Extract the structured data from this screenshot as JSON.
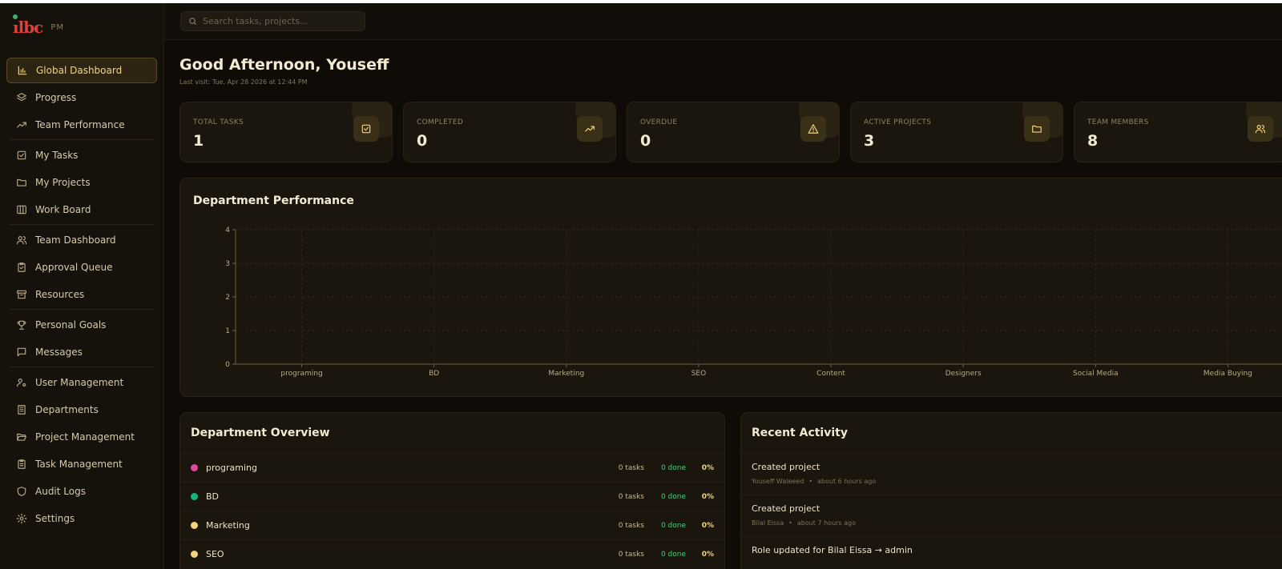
{
  "app": {
    "logo_text": "ılbc",
    "logo_sub": "PM"
  },
  "search": {
    "placeholder": "Search tasks, projects..."
  },
  "sidebar": {
    "items": [
      {
        "label": "Global Dashboard",
        "icon": "bar-chart-icon",
        "active": true
      },
      {
        "label": "Progress",
        "icon": "layers-icon"
      },
      {
        "label": "Team Performance",
        "icon": "trending-up-icon"
      },
      {
        "label": "My Tasks",
        "icon": "check-square-icon"
      },
      {
        "label": "My Projects",
        "icon": "folder-icon"
      },
      {
        "label": "Work Board",
        "icon": "columns-icon"
      },
      {
        "label": "Team Dashboard",
        "icon": "users-icon"
      },
      {
        "label": "Approval Queue",
        "icon": "clipboard-check-icon"
      },
      {
        "label": "Resources",
        "icon": "archive-icon"
      },
      {
        "label": "Personal Goals",
        "icon": "trophy-icon"
      },
      {
        "label": "Messages",
        "icon": "message-icon"
      },
      {
        "label": "User Management",
        "icon": "user-cog-icon"
      },
      {
        "label": "Departments",
        "icon": "building-icon"
      },
      {
        "label": "Project Management",
        "icon": "folder-open-icon"
      },
      {
        "label": "Task Management",
        "icon": "clipboard-list-icon"
      },
      {
        "label": "Audit Logs",
        "icon": "shield-icon"
      },
      {
        "label": "Settings",
        "icon": "gear-icon"
      }
    ]
  },
  "header": {
    "greeting": "Good Afternoon, Youseff",
    "last_visit": "Last visit: Tue, Apr 28 2026 at 12:44 PM"
  },
  "stats": [
    {
      "label": "TOTAL TASKS",
      "value": "1",
      "icon": "check-square-icon"
    },
    {
      "label": "COMPLETED",
      "value": "0",
      "icon": "trending-up-icon"
    },
    {
      "label": "OVERDUE",
      "value": "0",
      "icon": "alert-triangle-icon"
    },
    {
      "label": "ACTIVE PROJECTS",
      "value": "3",
      "icon": "folder-icon"
    },
    {
      "label": "TEAM MEMBERS",
      "value": "8",
      "icon": "users-icon"
    }
  ],
  "dept_performance": {
    "title": "Department Performance"
  },
  "chart_data": {
    "type": "bar",
    "title": "Department Performance",
    "categories": [
      "programing",
      "BD",
      "Marketing",
      "SEO",
      "Content",
      "Designers",
      "Social Media",
      "Media Buying"
    ],
    "values": [
      0,
      0,
      0,
      0,
      0,
      0,
      0,
      0
    ],
    "ylim": [
      0,
      4
    ],
    "yticks": [
      "0",
      "1",
      "2",
      "3",
      "4"
    ],
    "grid": true
  },
  "dept_overview": {
    "title": "Department Overview",
    "rows": [
      {
        "name": "programing",
        "color": "#e0489a",
        "tasks": "0 tasks",
        "done": "0 done",
        "pct": "0%"
      },
      {
        "name": "BD",
        "color": "#14b87c",
        "tasks": "0 tasks",
        "done": "0 done",
        "pct": "0%"
      },
      {
        "name": "Marketing",
        "color": "#f1d57a",
        "tasks": "0 tasks",
        "done": "0 done",
        "pct": "0%"
      },
      {
        "name": "SEO",
        "color": "#f1d57a",
        "tasks": "0 tasks",
        "done": "0 done",
        "pct": "0%"
      }
    ]
  },
  "recent_activity": {
    "title": "Recent Activity",
    "items": [
      {
        "title": "Created project",
        "user": "Youseff Waleeed",
        "time": "about 6 hours ago"
      },
      {
        "title": "Created project",
        "user": "Bilal Eissa",
        "time": "about 7 hours ago"
      },
      {
        "title": "Role updated for Bilal Eissa → admin",
        "user": "",
        "time": ""
      }
    ]
  }
}
